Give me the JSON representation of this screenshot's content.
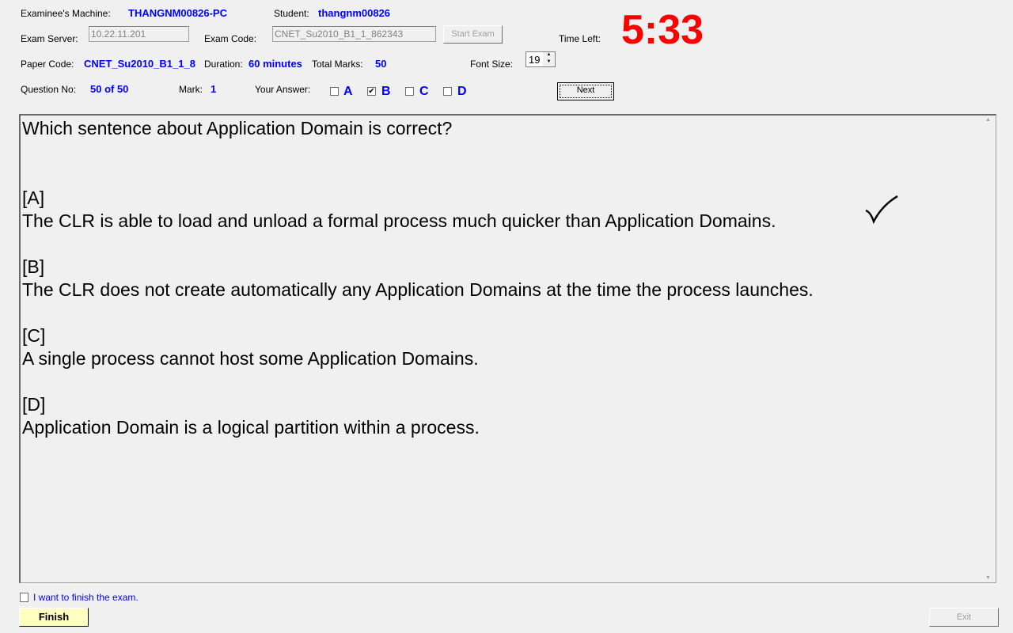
{
  "header": {
    "machine_label": "Examinee's Machine:",
    "machine": "THANGNM00826-PC",
    "student_label": "Student:",
    "student": "thangnm00826",
    "server_label": "Exam Server:",
    "server": "10.22.11.201",
    "code_label": "Exam Code:",
    "code": "CNET_Su2010_B1_1_862343",
    "start_exam": "Start Exam",
    "time_label": "Time Left:",
    "time": "5:33",
    "paper_label": "Paper Code:",
    "paper": "CNET_Su2010_B1_1_8",
    "duration_label": "Duration:",
    "duration": "60 minutes",
    "marks_label": "Total Marks:",
    "marks": "50",
    "font_label": "Font Size:",
    "font_size": "19",
    "question_label": "Question No:",
    "question": "50 of 50",
    "mark_label": "Mark:",
    "mark": "1",
    "answer_label": "Your Answer:",
    "options": [
      {
        "label": "A",
        "checked": false
      },
      {
        "label": "B",
        "checked": true
      },
      {
        "label": "C",
        "checked": false
      },
      {
        "label": "D",
        "checked": false
      }
    ],
    "next": "Next"
  },
  "question": {
    "text": "Which sentence about Application Domain is correct?",
    "answers": [
      {
        "tag": "[A]",
        "text": "The CLR is able to load and unload a formal process much quicker than Application Domains."
      },
      {
        "tag": "[B]",
        "text": "The CLR does not create automatically any Application Domains at the time the process launches."
      },
      {
        "tag": "[C]",
        "text": "A single process cannot host some Application Domains."
      },
      {
        "tag": "[D]",
        "text": "Application Domain is a logical partition within a process."
      }
    ]
  },
  "footer": {
    "finish_check": "I want to finish the exam.",
    "finish": "Finish",
    "exit": "Exit"
  },
  "colors": {
    "value": "#0000ff",
    "timer": "#ff0000",
    "finish_bg": "#ffffc0"
  }
}
